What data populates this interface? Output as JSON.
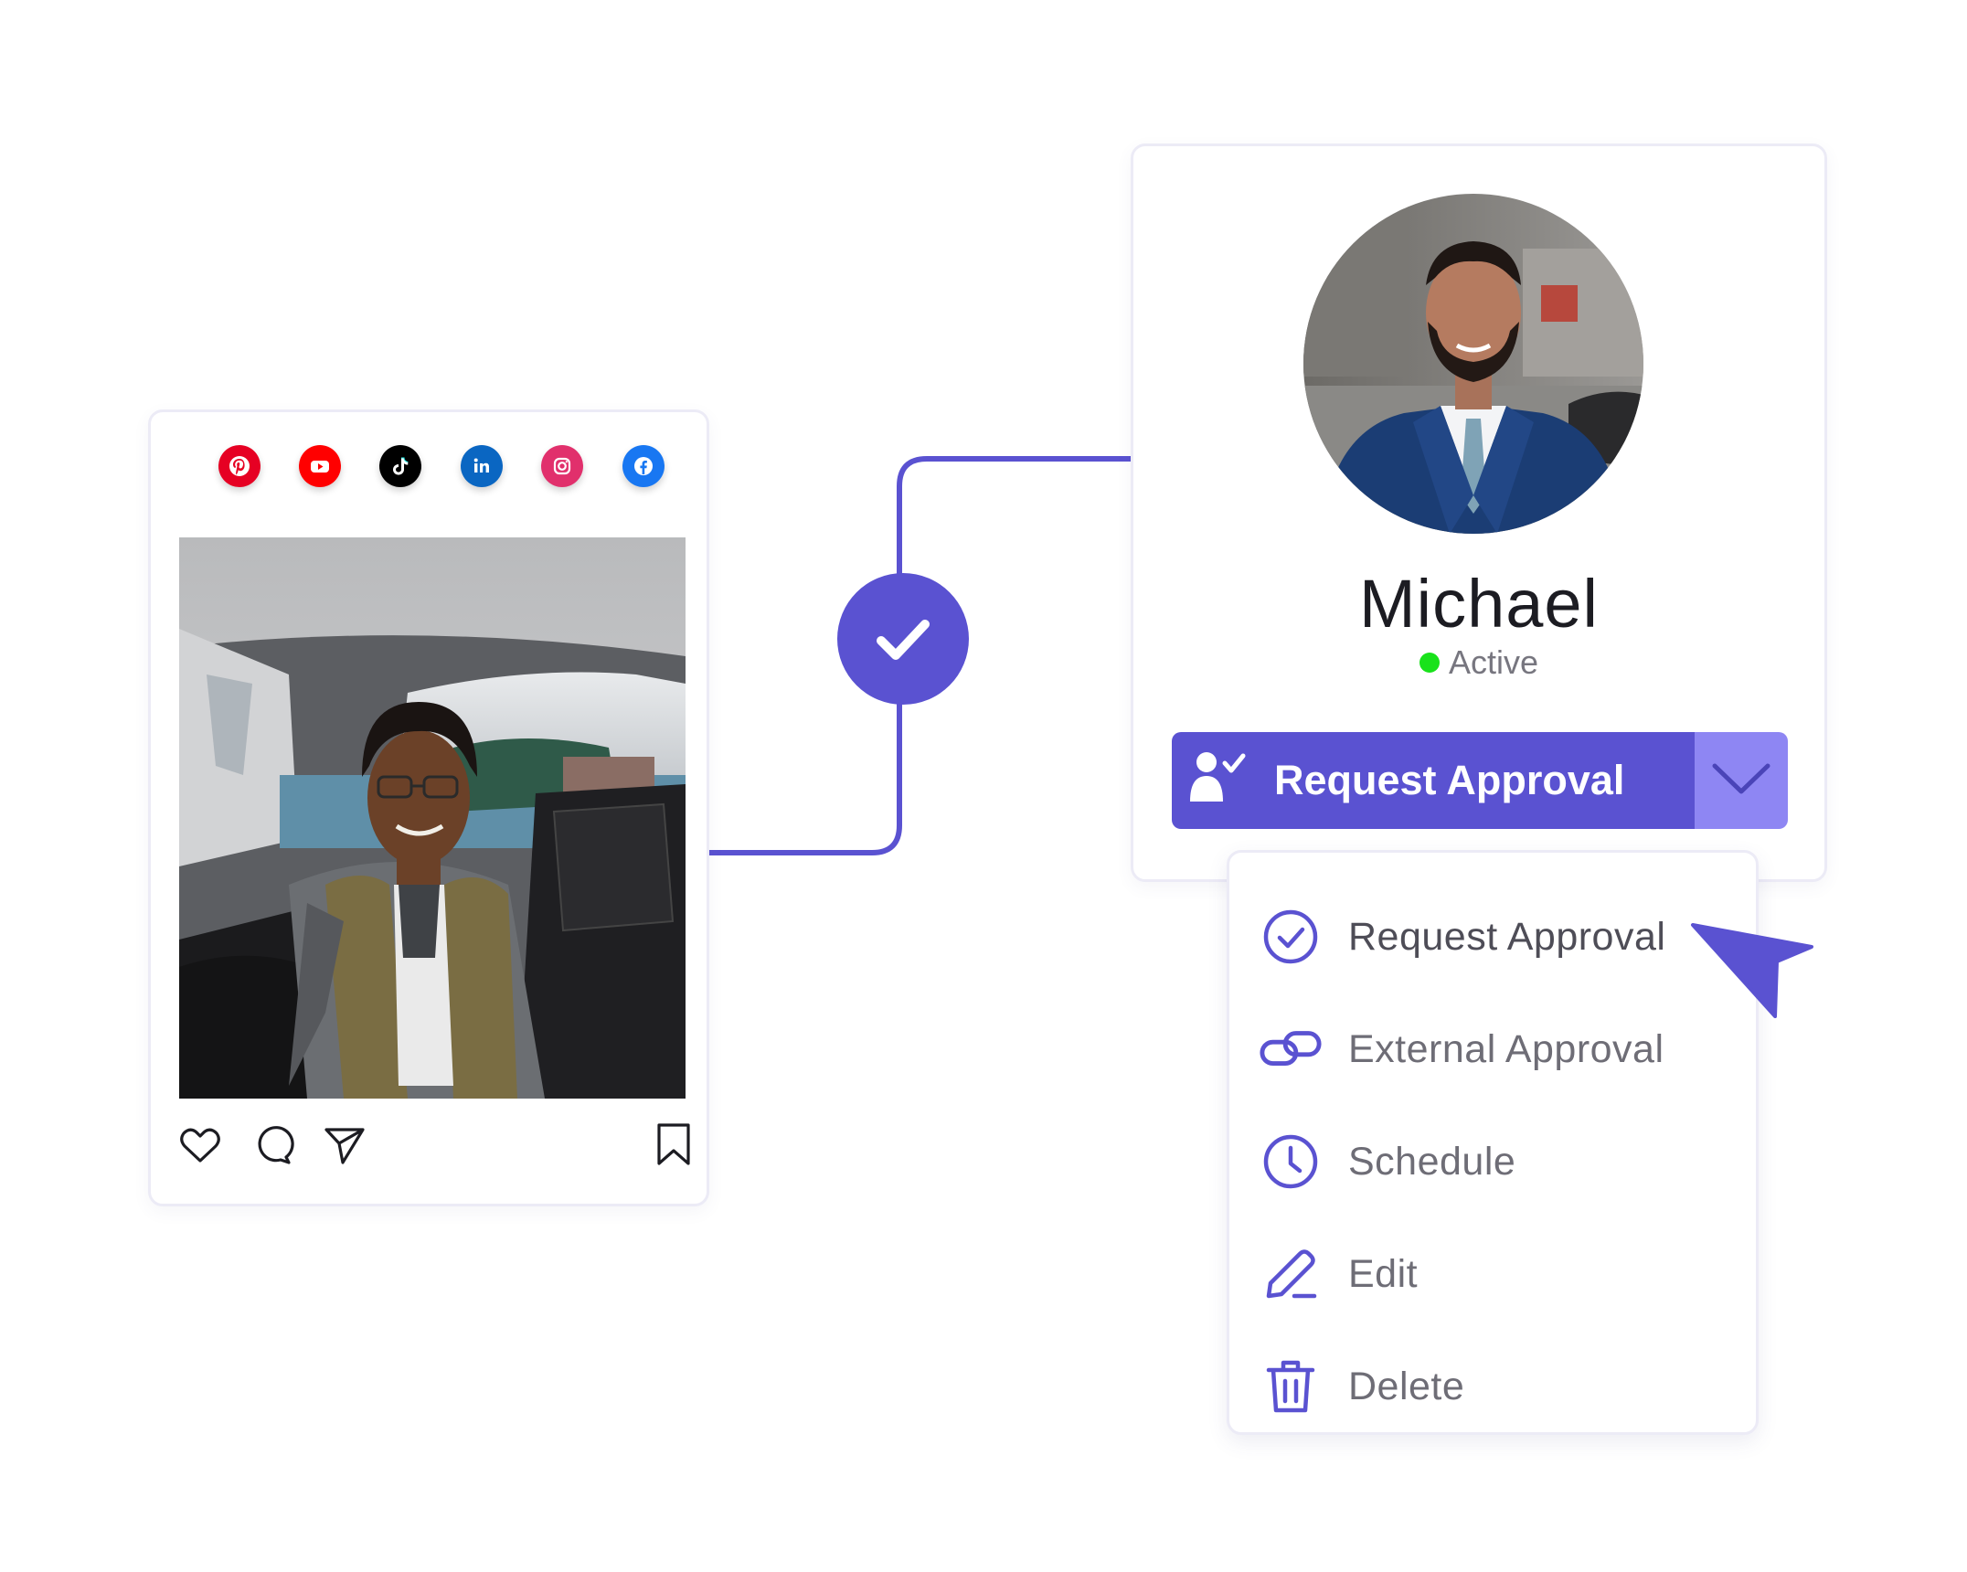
{
  "social_icons": [
    {
      "name": "pinterest-icon",
      "color": "#e60023"
    },
    {
      "name": "youtube-icon",
      "color": "#ff0000"
    },
    {
      "name": "tiktok-icon",
      "color": "#000000"
    },
    {
      "name": "linkedin-icon",
      "color": "#0a66c2"
    },
    {
      "name": "instagram-icon",
      "color": "#e1306c"
    },
    {
      "name": "facebook-icon",
      "color": "#1877f2"
    }
  ],
  "post": {
    "actions": [
      "heart-icon",
      "comment-icon",
      "share-icon",
      "bookmark-icon"
    ]
  },
  "profile": {
    "name": "Michael",
    "status": "Active",
    "status_color": "#19e21b"
  },
  "split_button": {
    "label": "Request Approval",
    "icon": "user-check-icon",
    "toggle_icon": "chevron-down-icon"
  },
  "menu": {
    "items": [
      {
        "label": "Request Approval",
        "icon": "check-circle-icon"
      },
      {
        "label": "External Approval",
        "icon": "link-icon"
      },
      {
        "label": "Schedule",
        "icon": "clock-icon"
      },
      {
        "label": "Edit",
        "icon": "pen-icon"
      },
      {
        "label": "Delete",
        "icon": "trash-icon"
      }
    ]
  },
  "colors": {
    "accent": "#5a52d1",
    "accent_light": "#8e86f3",
    "border": "#ecebf6"
  }
}
